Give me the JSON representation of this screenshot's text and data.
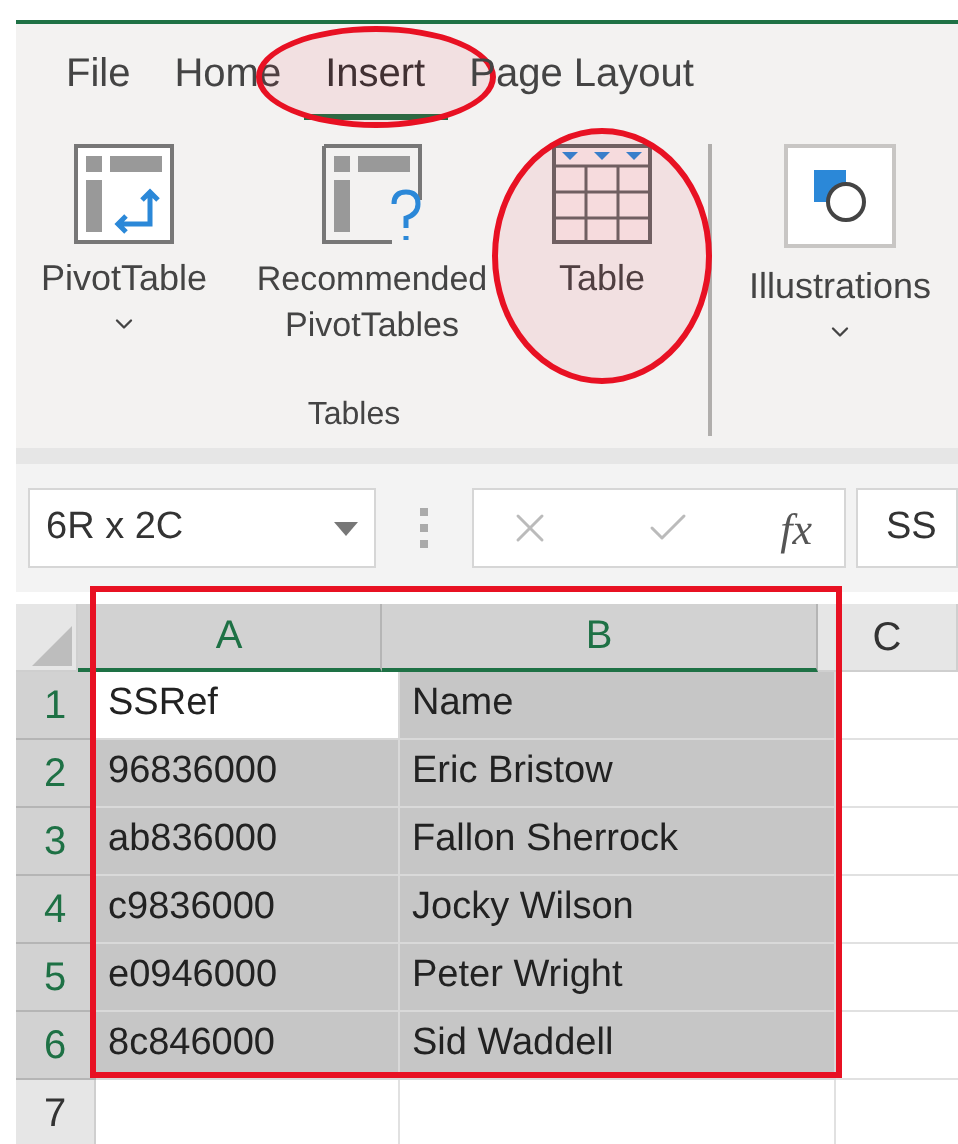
{
  "ribbon": {
    "tabs": [
      {
        "label": "File",
        "selected": false,
        "circled": false
      },
      {
        "label": "Home",
        "selected": false,
        "circled": false
      },
      {
        "label": "Insert",
        "selected": true,
        "circled": true
      },
      {
        "label": "Page Layout",
        "selected": false,
        "circled": false
      }
    ],
    "groups": [
      {
        "label": "Tables",
        "buttons": [
          {
            "kind": "pivot",
            "label": "PivotTable",
            "dropdown": true,
            "circled": false
          },
          {
            "kind": "recommended",
            "label": "Recommended PivotTables",
            "dropdown": false,
            "circled": false
          },
          {
            "kind": "table",
            "label": "Table",
            "dropdown": false,
            "circled": true
          }
        ]
      },
      {
        "buttons": [
          {
            "kind": "shapes",
            "label": "Illustrations",
            "dropdown": true,
            "circled": false
          }
        ]
      }
    ]
  },
  "formula_bar": {
    "name_box": "6R x 2C",
    "fx": "fx",
    "content": "SS"
  },
  "sheet": {
    "outlined": true,
    "columns": [
      {
        "label": "A",
        "selected": true
      },
      {
        "label": "B",
        "selected": true
      },
      {
        "label": "C",
        "selected": false
      }
    ],
    "rows": [
      {
        "header": "1",
        "selected": true,
        "cells": [
          {
            "text": "SSRef",
            "active": true
          },
          {
            "text": "Name",
            "active": false
          }
        ]
      },
      {
        "header": "2",
        "selected": true,
        "cells": [
          {
            "text": "96836000",
            "active": false
          },
          {
            "text": "Eric Bristow",
            "active": false
          }
        ]
      },
      {
        "header": "3",
        "selected": true,
        "cells": [
          {
            "text": "ab836000",
            "active": false
          },
          {
            "text": "Fallon Sherrock",
            "active": false
          }
        ]
      },
      {
        "header": "4",
        "selected": true,
        "cells": [
          {
            "text": "c9836000",
            "active": false
          },
          {
            "text": "Jocky Wilson",
            "active": false
          }
        ]
      },
      {
        "header": "5",
        "selected": true,
        "cells": [
          {
            "text": "e0946000",
            "active": false
          },
          {
            "text": "Peter Wright",
            "active": false
          }
        ]
      },
      {
        "header": "6",
        "selected": true,
        "cells": [
          {
            "text": "8c846000",
            "active": false
          },
          {
            "text": "Sid Waddell",
            "active": false
          }
        ]
      },
      {
        "header": "7",
        "selected": false,
        "cells": []
      }
    ]
  }
}
